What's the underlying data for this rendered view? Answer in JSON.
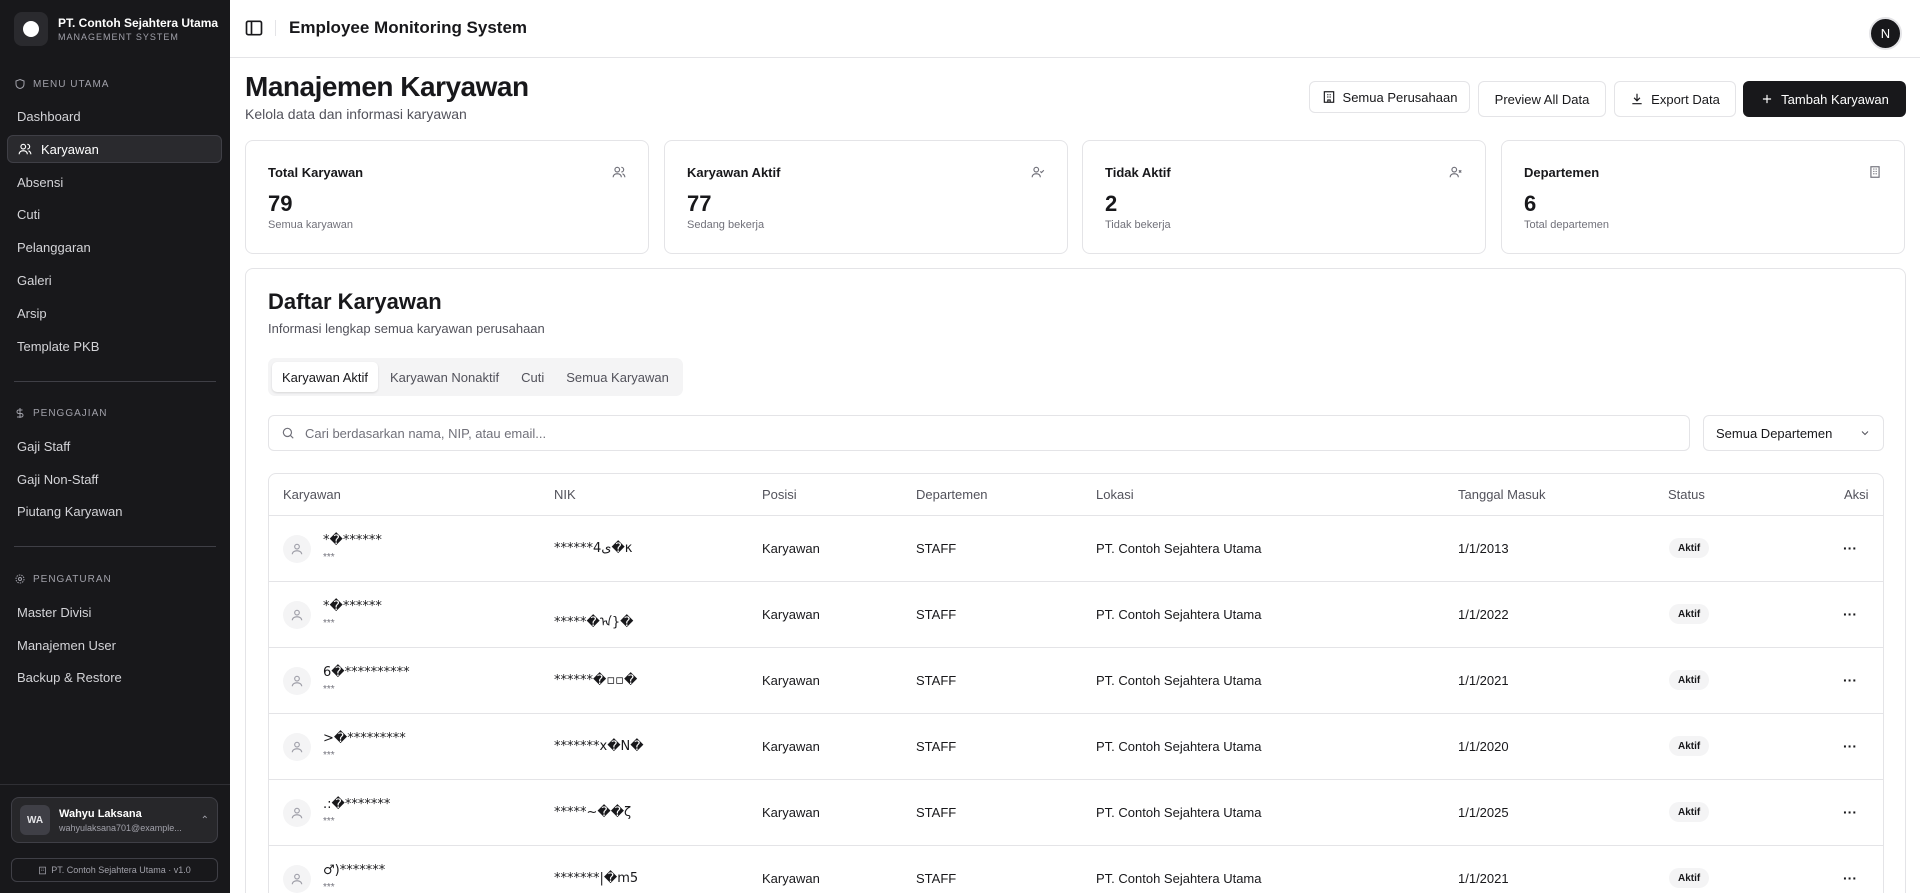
{
  "sidebar": {
    "brand_name": "PT. Contoh Sejahtera Utama",
    "brand_sub": "MANAGEMENT SYSTEM",
    "sections": {
      "utama": "MENU UTAMA",
      "penggajian": "PENGGAJIAN",
      "pengaturan": "PENGATURAN"
    },
    "items": {
      "dashboard": "Dashboard",
      "karyawan": "Karyawan",
      "absensi": "Absensi",
      "cuti": "Cuti",
      "pelanggaran": "Pelanggaran",
      "galeri": "Galeri",
      "arsip": "Arsip",
      "template_pkb": "Template PKB",
      "gaji_staff": "Gaji Staff",
      "gaji_non_staff": "Gaji Non-Staff",
      "piutang": "Piutang Karyawan",
      "master_divisi": "Master Divisi",
      "manajemen_user": "Manajemen User",
      "backup": "Backup & Restore"
    },
    "user": {
      "initials": "WA",
      "name": "Wahyu Laksana",
      "email": "wahyulaksana701@example..."
    },
    "version": "PT. Contoh Sejahtera Utama · v1.0"
  },
  "header": {
    "title": "Employee Monitoring System",
    "avatar": "N"
  },
  "page": {
    "title": "Manajemen Karyawan",
    "subtitle": "Kelola data dan informasi karyawan",
    "buttons": {
      "company": "Semua Perusahaan",
      "preview": "Preview All Data",
      "export": "Export Data",
      "add": "Tambah Karyawan"
    }
  },
  "stats": [
    {
      "label": "Total Karyawan",
      "value": "79",
      "note": "Semua karyawan"
    },
    {
      "label": "Karyawan Aktif",
      "value": "77",
      "note": "Sedang bekerja"
    },
    {
      "label": "Tidak Aktif",
      "value": "2",
      "note": "Tidak bekerja"
    },
    {
      "label": "Departemen",
      "value": "6",
      "note": "Total departemen"
    }
  ],
  "list": {
    "title": "Daftar Karyawan",
    "subtitle": "Informasi lengkap semua karyawan perusahaan",
    "tabs": [
      "Karyawan Aktif",
      "Karyawan Nonaktif",
      "Cuti",
      "Semua Karyawan"
    ],
    "search_placeholder": "Cari berdasarkan nama, NIP, atau email...",
    "dept_filter": "Semua Departemen",
    "columns": [
      "Karyawan",
      "NIK",
      "Posisi",
      "Departemen",
      "Lokasi",
      "Tanggal Masuk",
      "Status",
      "Aksi"
    ],
    "rows": [
      {
        "name": "*�******",
        "sub": "***",
        "nik": "******4ى�κ",
        "posisi": "Karyawan",
        "dept": "STAFF",
        "lokasi": "PT. Contoh Sejahtera Utama",
        "tanggal": "1/1/2013",
        "status": "Aktif"
      },
      {
        "name": "*�******",
        "sub": "***",
        "nik": "*****�ᠠ}�",
        "posisi": "Karyawan",
        "dept": "STAFF",
        "lokasi": "PT. Contoh Sejahtera Utama",
        "tanggal": "1/1/2022",
        "status": "Aktif"
      },
      {
        "name": "6�**********",
        "sub": "***",
        "nik": "******�▫▫�",
        "posisi": "Karyawan",
        "dept": "STAFF",
        "lokasi": "PT. Contoh Sejahtera Utama",
        "tanggal": "1/1/2021",
        "status": "Aktif"
      },
      {
        "name": ">�*********",
        "sub": "***",
        "nik": "*******x�N�",
        "posisi": "Karyawan",
        "dept": "STAFF",
        "lokasi": "PT. Contoh Sejahtera Utama",
        "tanggal": "1/1/2020",
        "status": "Aktif"
      },
      {
        "name": ".:�*******",
        "sub": "***",
        "nik": "*****~��ζ",
        "posisi": "Karyawan",
        "dept": "STAFF",
        "lokasi": "PT. Contoh Sejahtera Utama",
        "tanggal": "1/1/2025",
        "status": "Aktif"
      },
      {
        "name": "♂)*******",
        "sub": "***",
        "nik": "*******|�m5",
        "posisi": "Karyawan",
        "dept": "STAFF",
        "lokasi": "PT. Contoh Sejahtera Utama",
        "tanggal": "1/1/2021",
        "status": "Aktif"
      }
    ]
  }
}
